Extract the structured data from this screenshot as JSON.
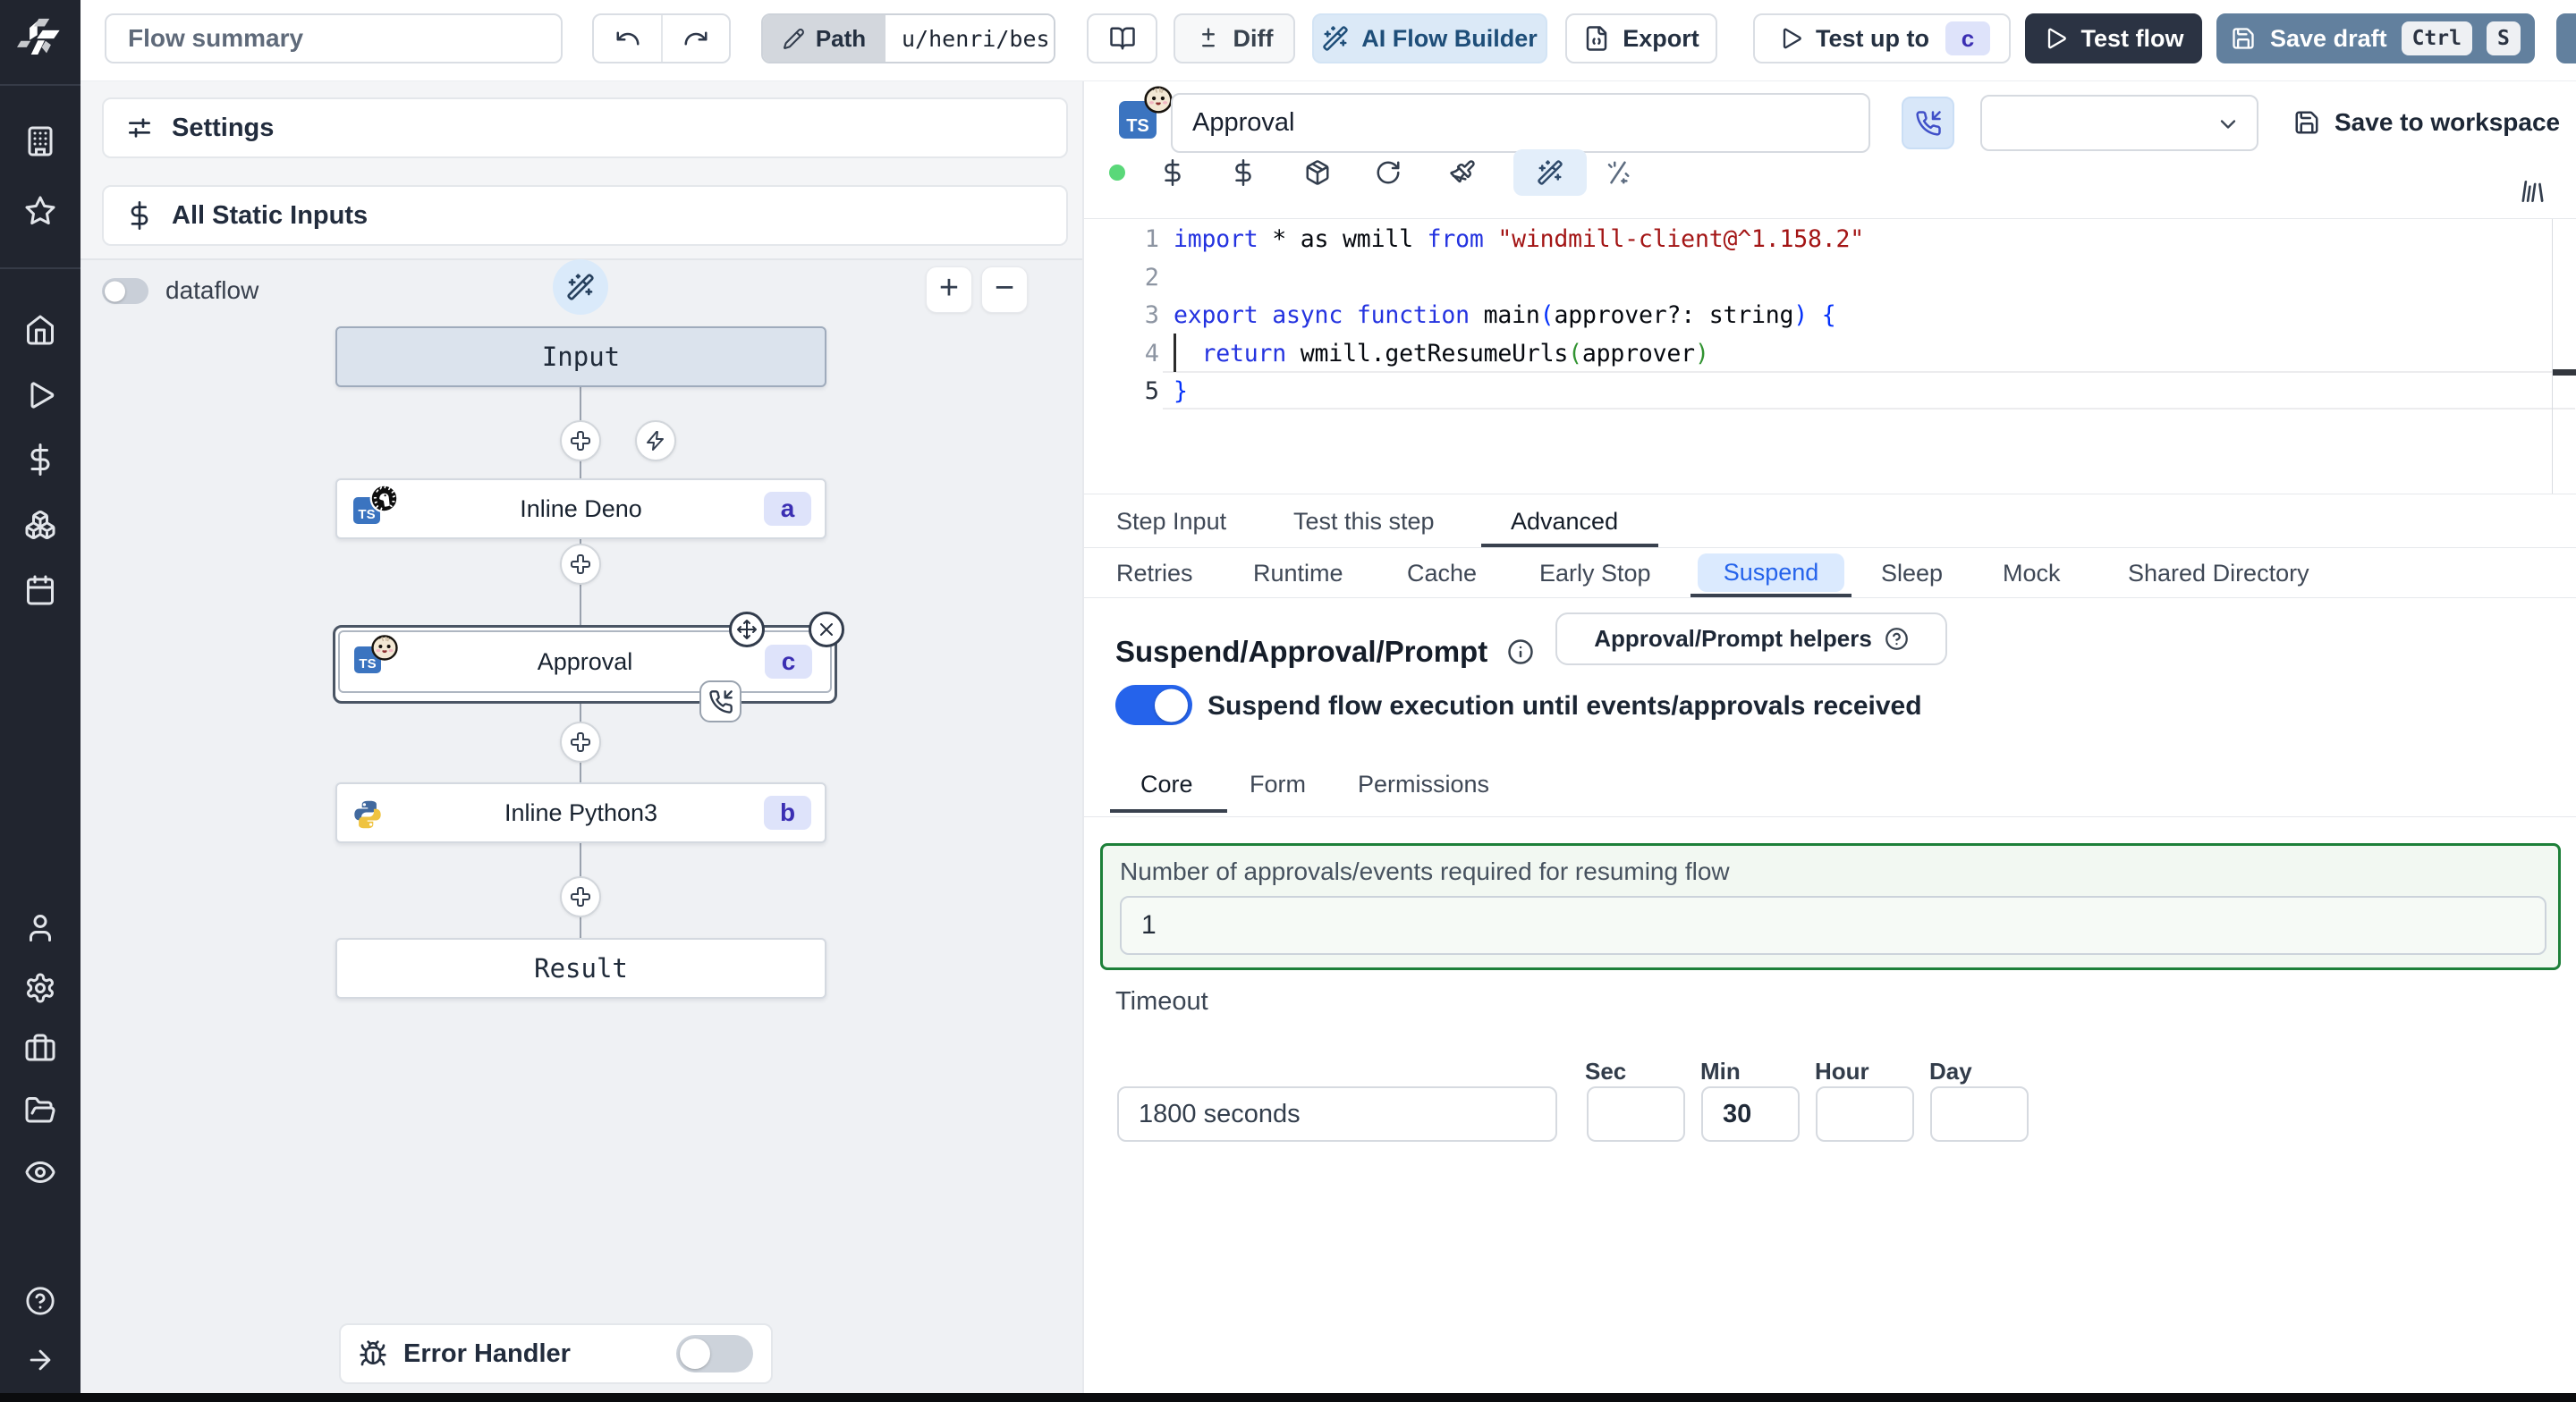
{
  "topbar": {
    "flow_summary_placeholder": "Flow summary",
    "path_label": "Path",
    "path_value": "u/henri/bes",
    "diff_label": "Diff",
    "ai_flow_builder_label": "AI Flow Builder",
    "export_label": "Export",
    "test_up_to_label": "Test up to",
    "test_up_to_badge": "c",
    "test_flow_label": "Test flow",
    "save_draft_label": "Save draft",
    "save_draft_kbd": [
      "Ctrl",
      "S"
    ]
  },
  "sidebar": {
    "icons": [
      "windmill-logo",
      "building",
      "star",
      "home",
      "runs-play",
      "variables-dollar",
      "resources-boxes",
      "schedules-calendar",
      "user",
      "settings-gear",
      "workers-briefcase",
      "folders",
      "audit-eye",
      "help-question",
      "collapse-arrow-right"
    ]
  },
  "graph": {
    "settings_label": "Settings",
    "static_inputs_label": "All Static Inputs",
    "dataflow_label": "dataflow",
    "zoom_in_label": "+",
    "zoom_out_label": "−",
    "nodes": {
      "input": {
        "label": "Input"
      },
      "deno": {
        "label": "Inline Deno",
        "badge": "a"
      },
      "approval": {
        "label": "Approval",
        "badge": "c"
      },
      "python": {
        "label": "Inline Python3",
        "badge": "b"
      },
      "result": {
        "label": "Result"
      }
    },
    "error_handler_label": "Error Handler",
    "error_handler_enabled": false,
    "dataflow_enabled": false
  },
  "step": {
    "name": "Approval",
    "language": "TS",
    "save_to_workspace_label": "Save to workspace",
    "status_dot_color": "#6fdd8b"
  },
  "editor": {
    "line_numbers": [
      "1",
      "2",
      "3",
      "4",
      "5"
    ],
    "active_line": "5",
    "code_text": "import * as wmill from \"windmill-client@^1.158.2\"\n\nexport async function main(approver?: string) {\n  return wmill.getResumeUrls(approver)\n}",
    "lines": [
      [
        {
          "c": "kw",
          "t": "import"
        },
        {
          "c": "pl",
          "t": " * as wmill "
        },
        {
          "c": "kw",
          "t": "from"
        },
        {
          "c": "str",
          "t": " \"windmill-client@^1.158.2\""
        }
      ],
      [],
      [
        {
          "c": "kw",
          "t": "export"
        },
        {
          "c": "pl",
          "t": " "
        },
        {
          "c": "kw",
          "t": "async"
        },
        {
          "c": "pl",
          "t": " "
        },
        {
          "c": "kw",
          "t": "function"
        },
        {
          "c": "pl",
          "t": " main"
        },
        {
          "c": "b0",
          "t": "("
        },
        {
          "c": "pl",
          "t": "approver?: string"
        },
        {
          "c": "b0",
          "t": ")"
        },
        {
          "c": "pl",
          "t": " "
        },
        {
          "c": "b0",
          "t": "{"
        }
      ],
      [
        {
          "c": "pl",
          "t": "  "
        },
        {
          "c": "kw",
          "t": "return"
        },
        {
          "c": "pl",
          "t": " wmill.getResumeUrls"
        },
        {
          "c": "b1",
          "t": "("
        },
        {
          "c": "pl",
          "t": "approver"
        },
        {
          "c": "b1",
          "t": ")"
        }
      ],
      [
        {
          "c": "b0",
          "t": "}"
        }
      ]
    ]
  },
  "tabs": {
    "items": [
      "Step Input",
      "Test this step",
      "Advanced"
    ],
    "active": "Advanced"
  },
  "subtabs": {
    "items": [
      "Retries",
      "Runtime",
      "Cache",
      "Early Stop",
      "Suspend",
      "Sleep",
      "Mock",
      "Shared Directory"
    ],
    "active": "Suspend"
  },
  "suspend": {
    "title": "Suspend/Approval/Prompt",
    "helpers_button_label": "Approval/Prompt helpers",
    "toggle_label": "Suspend flow execution until events/approvals received",
    "toggle_on": true,
    "core_tabs": [
      "Core",
      "Form",
      "Permissions"
    ],
    "active_core_tab": "Core",
    "required_events_label": "Number of approvals/events required for resuming flow",
    "required_events_value": "1",
    "timeout_label": "Timeout",
    "timeout_display_value": "1800 seconds",
    "unit_labels": [
      "Sec",
      "Min",
      "Hour",
      "Day"
    ],
    "sec_value": "",
    "min_value": "30",
    "hour_value": "",
    "day_value": ""
  },
  "colors": {
    "accent_blue": "#2563eb",
    "highlight_green_border": "#1d8039",
    "badge_bg": "#dee3fa",
    "badge_text": "#3b2fb3",
    "ai_button_bg": "#dbe9f7",
    "ai_button_text": "#1e4e79",
    "test_flow_bg": "#2b3343",
    "save_draft_bg": "#62809e",
    "sidebar_bg": "#21252f"
  }
}
